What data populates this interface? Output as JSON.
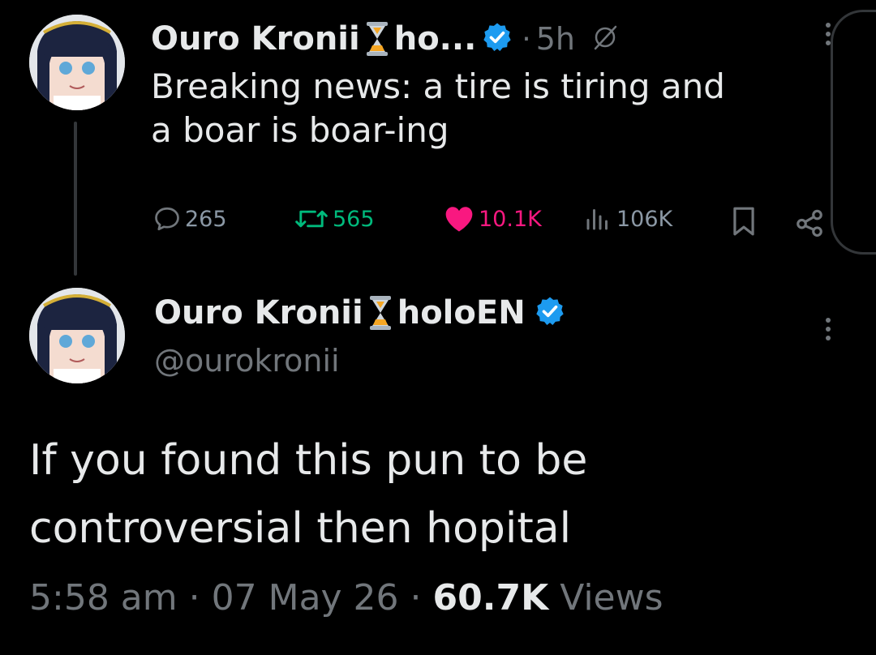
{
  "parent_tweet": {
    "display_name": "Ouro Kronii",
    "name_suffix_truncated": "ho...",
    "separator": "·",
    "time_ago": "5h",
    "text_line1": "Breaking news: a tire is tiring and",
    "text_line2": "a boar is boar-ing",
    "stats": {
      "replies": "265",
      "reposts": "565",
      "likes": "10.1K",
      "views": "106K"
    }
  },
  "main_tweet": {
    "display_name": "Ouro Kronii",
    "name_suffix": "holoEN",
    "handle": "@ourokronii",
    "text_line1": "If you found this pun to be",
    "text_line2": "controversial then hopital",
    "time": "5:58 am",
    "sep1": "·",
    "date": "07 May 26",
    "sep2": "·",
    "views_count": "60.7K",
    "views_label": "Views"
  },
  "colors": {
    "background": "#000000",
    "text": "#e7e9ea",
    "muted": "#71767b",
    "verified": "#1d9bf0",
    "repost": "#00ba7c",
    "like": "#f91880"
  },
  "icons": [
    "hourglass-icon",
    "verified-badge-icon",
    "grok-icon",
    "more-icon",
    "reply-icon",
    "repost-icon",
    "like-icon",
    "views-icon",
    "bookmark-icon",
    "share-icon"
  ]
}
